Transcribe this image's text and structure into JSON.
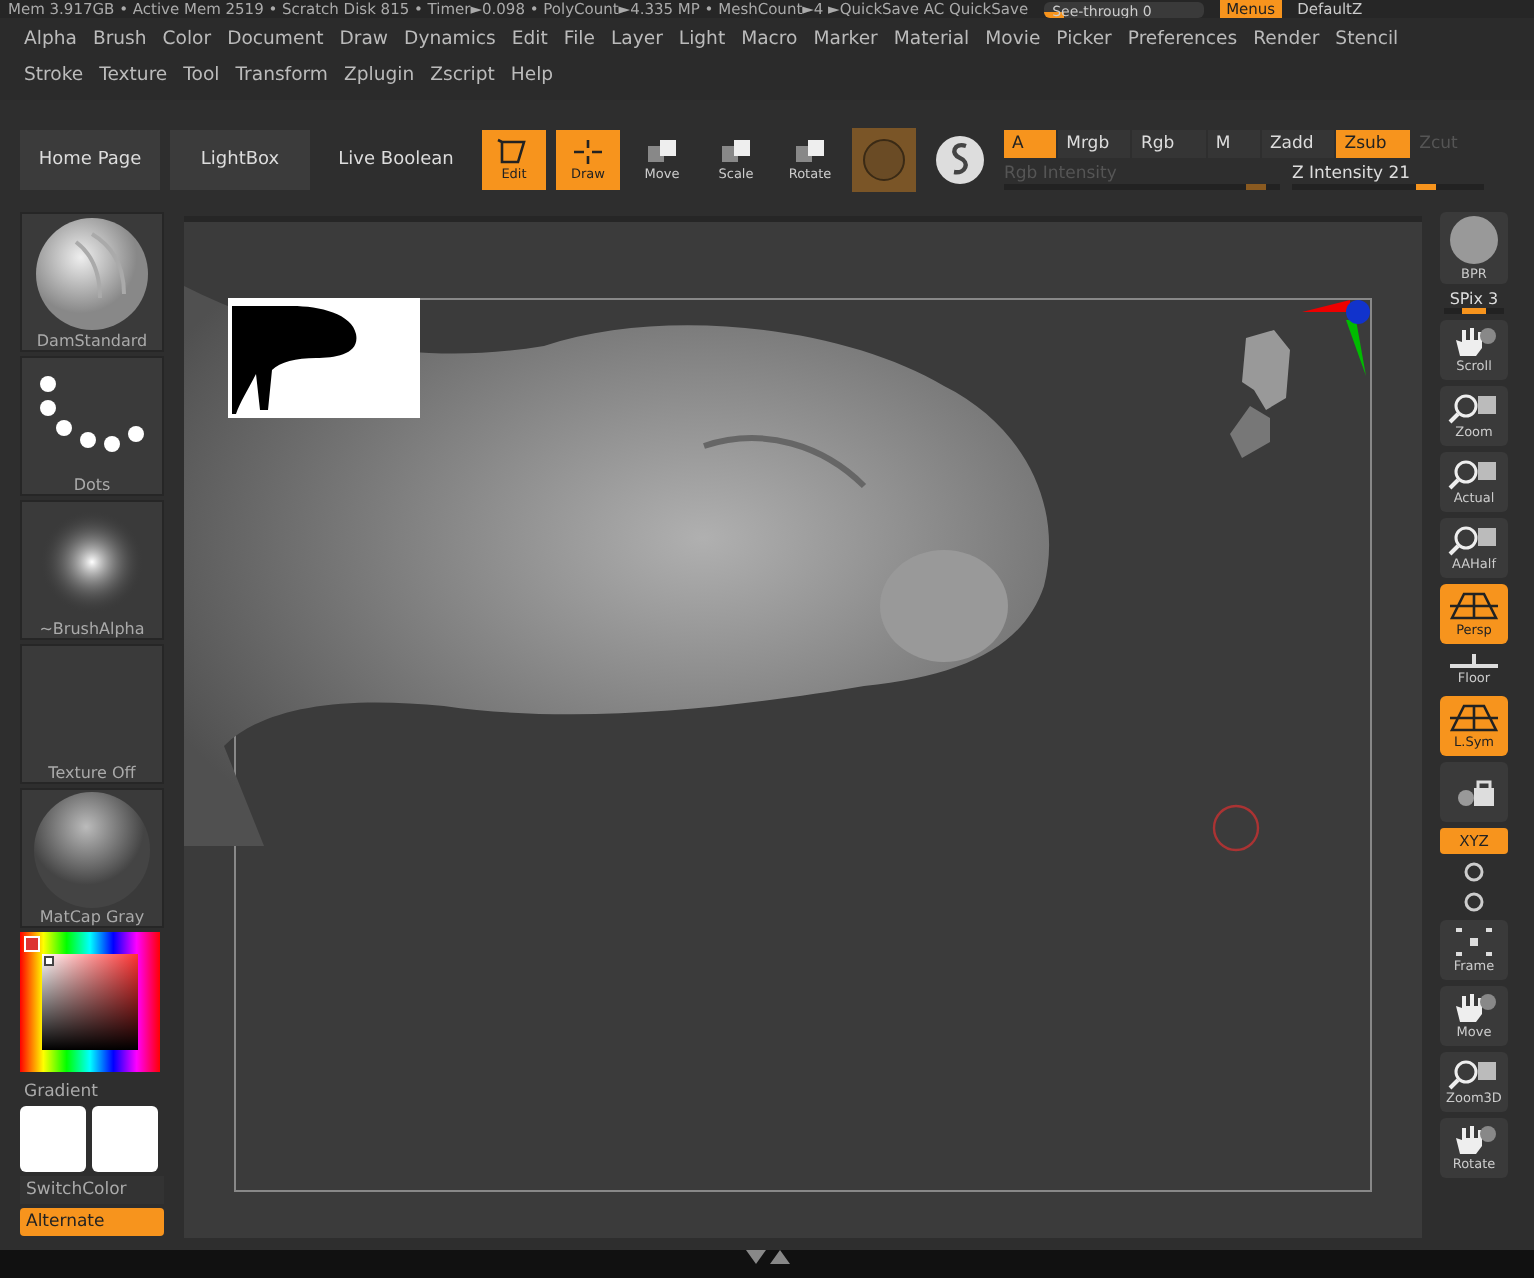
{
  "status_bar": {
    "text": "Mem 3.917GB • Active Mem 2519 • Scratch Disk 815 • Timer►0.098 • PolyCount►4.335 MP • MeshCount►4 ►QuickSave AC    QuickSave",
    "see_through": {
      "label": "See-through 0",
      "level": 0.12
    },
    "menus_button": {
      "label": "Menus",
      "selected": true
    },
    "default_label": "DefaultZ"
  },
  "menu_bar": {
    "rows": [
      [
        "Alpha",
        "Brush",
        "Color",
        "Document",
        "Draw",
        "Dynamics",
        "Edit",
        "File",
        "Layer",
        "Light",
        "Macro",
        "Marker",
        "Material",
        "Movie",
        "Picker",
        "Preferences",
        "Render",
        "Stencil"
      ],
      [
        "Stroke",
        "Texture",
        "Tool",
        "Transform",
        "Zplugin",
        "Zscript",
        "Help"
      ]
    ]
  },
  "toolbar": {
    "nav_buttons": [
      "Home Page",
      "LightBox",
      "Live Boolean"
    ],
    "mode_buttons": [
      {
        "label": "Edit",
        "kind": "edit",
        "selected": true
      },
      {
        "label": "Draw",
        "kind": "draw",
        "selected": true
      },
      {
        "label": "Move",
        "kind": "move",
        "selected": false
      },
      {
        "label": "Scale",
        "kind": "scale",
        "selected": false
      },
      {
        "label": "Rotate",
        "kind": "rotate",
        "selected": false
      }
    ],
    "channels": [
      {
        "label": "A",
        "selected": true
      },
      {
        "label": "Mrgb",
        "selected": false
      },
      {
        "label": "Rgb",
        "selected": false
      },
      {
        "label": "M",
        "selected": false
      }
    ],
    "z_modes": [
      {
        "label": "Zadd",
        "selected": false,
        "disabled": false
      },
      {
        "label": "Zsub",
        "selected": true,
        "disabled": false
      },
      {
        "label": "Zcut",
        "selected": false,
        "disabled": true
      }
    ],
    "rgb_intensity": {
      "label": "Rgb Intensity",
      "level": 0.95,
      "disabled": true
    },
    "z_intensity": {
      "label": "Z Intensity 21",
      "level": 0.75,
      "disabled": false
    }
  },
  "left_panel": {
    "tiles": [
      {
        "label": "DamStandard",
        "kind": "brush"
      },
      {
        "label": "Dots",
        "kind": "stroke"
      },
      {
        "label": "~BrushAlpha",
        "kind": "alpha"
      },
      {
        "label": "Texture Off",
        "kind": "texture"
      },
      {
        "label": "MatCap Gray",
        "kind": "material"
      }
    ],
    "gradient_label": "Gradient",
    "switch_color": "SwitchColor",
    "alternate": {
      "label": "Alternate",
      "selected": true
    }
  },
  "right_shelf": [
    {
      "label": "BPR",
      "kind": "bpr",
      "selected": false
    },
    {
      "label": "SPix 3",
      "kind": "slider",
      "level": 0.5
    },
    {
      "label": "Scroll",
      "kind": "scroll",
      "selected": false
    },
    {
      "label": "Zoom",
      "kind": "zoom",
      "selected": false
    },
    {
      "label": "Actual",
      "kind": "actual",
      "selected": false
    },
    {
      "label": "AAHalf",
      "kind": "aahalf",
      "selected": false
    },
    {
      "label": "Persp",
      "kind": "persp",
      "selected": true
    },
    {
      "label": "Floor",
      "kind": "floor",
      "selected": false
    },
    {
      "label": "L.Sym",
      "kind": "lsym",
      "selected": true
    },
    {
      "kind": "lock",
      "selected": false
    },
    {
      "label": "XYZ",
      "kind": "xyz",
      "selected": true
    },
    {
      "kind": "rot-small",
      "selected": false
    },
    {
      "kind": "rot-small",
      "selected": false
    },
    {
      "label": "Frame",
      "kind": "frame",
      "selected": false
    },
    {
      "label": "Move",
      "kind": "move",
      "selected": false
    },
    {
      "label": "Zoom3D",
      "kind": "zoom3d",
      "selected": false
    },
    {
      "label": "Rotate",
      "kind": "rotate",
      "selected": false
    }
  ]
}
